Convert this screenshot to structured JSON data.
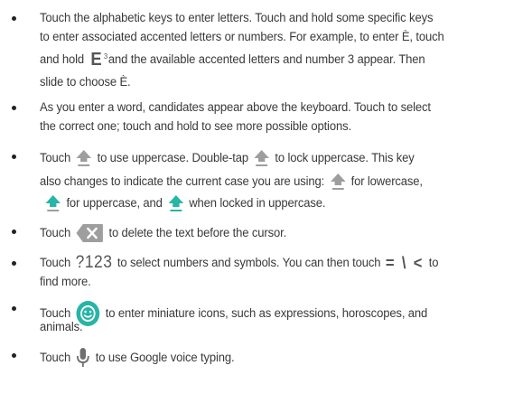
{
  "items": [
    {
      "lines": [
        [
          "Touch the alphabetic keys to enter letters. Touch and hold some specific keys"
        ],
        [
          "to enter associated accented letters or numbers. For example, to enter È, touch"
        ],
        [
          "and hold",
          "{keyE}",
          "and the available accented letters and number 3 appear. Then"
        ],
        [
          "slide to choose È."
        ]
      ]
    },
    {
      "lines": [
        [
          "As you enter a word, candidates appear above the keyboard. Touch to select"
        ],
        [
          "the correct one; touch and hold to see more possible options."
        ]
      ]
    },
    {
      "lines": [
        [
          "Touch",
          "{shift-gray}",
          "to use uppercase. Double-tap",
          "{shift-gray}",
          "to lock uppercase. This key"
        ],
        [
          "also changes to indicate the current case you are using:",
          "{shift-gray}",
          "for lowercase,"
        ],
        [
          "{shift-teal}",
          "for uppercase, and",
          "{shift-teal-bar}",
          "when locked in uppercase."
        ]
      ]
    },
    {
      "lines": [
        [
          "Touch",
          "{backspace}",
          "to delete the text before the cursor."
        ]
      ]
    },
    {
      "lines": [
        [
          "Touch",
          "{key123}",
          "to select numbers and symbols. You can then touch",
          "{keySym}",
          "to"
        ],
        [
          "find more."
        ]
      ]
    },
    {
      "lines": [
        [
          "Touch",
          "{emoji}",
          "to enter miniature icons, such as expressions, horoscopes, and"
        ],
        [
          "animals."
        ]
      ]
    },
    {
      "lines": [
        [
          "Touch",
          "{mic}",
          "to use Google voice typing."
        ]
      ]
    }
  ],
  "keys": {
    "keyE": "E",
    "keyE_sup": "3",
    "key123": "?123",
    "keySym": "= \\ <"
  },
  "icons": {
    "shift-gray": "shift-arrow-icon",
    "shift-teal": "shift-uppercase-icon",
    "shift-teal-bar": "shift-locked-icon",
    "backspace": "backspace-icon",
    "emoji": "emoji-icon",
    "mic": "microphone-icon"
  },
  "colors": {
    "text": "#3a3a3a",
    "icon_gray": "#9e9e9e",
    "accent_teal": "#26b5a7"
  }
}
